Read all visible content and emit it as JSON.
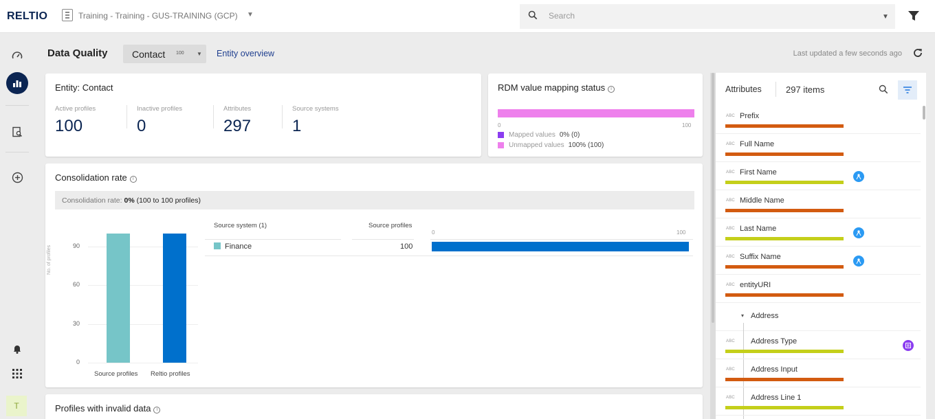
{
  "app": {
    "logo": "RELTIO",
    "tenant": "Training - Training - GUS-TRAINING (GCP)",
    "search_placeholder": "Search"
  },
  "icons": {
    "dashboard": "gauge-icon",
    "data_quality": "bar-chart-icon",
    "search_page": "document-search-icon",
    "add": "plus-circle-icon",
    "notifications": "bell-icon",
    "apps": "grid-icon",
    "filter": "funnel-icon",
    "refresh": "refresh-icon"
  },
  "colors": {
    "brand": "#0b2552",
    "mapped": "#8b3df0",
    "unmapped": "#ee80ec",
    "source_profiles_bar": "#76c5c8",
    "reltio_profiles_bar": "#0070cc",
    "quality_orange": "#d35b10",
    "quality_green": "#c4cf1a"
  },
  "user": {
    "initial": "T"
  },
  "header": {
    "title": "Data Quality",
    "entity": "Contact",
    "entity_count": "100",
    "entity_overview": "Entity overview",
    "last_updated": "Last updated a few seconds ago"
  },
  "entity_card": {
    "title": "Entity: Contact",
    "stats": [
      {
        "label": "Active profiles",
        "value": "100"
      },
      {
        "label": "Inactive profiles",
        "value": "0"
      },
      {
        "label": "Attributes",
        "value": "297"
      },
      {
        "label": "Source systems",
        "value": "1"
      }
    ]
  },
  "rdm_card": {
    "title": "RDM value mapping status",
    "axis_min": "0",
    "axis_max": "100",
    "mapped_label": "Mapped values",
    "mapped_value": "0% (0)",
    "unmapped_label": "Unmapped values",
    "unmapped_value": "100% (100)",
    "unmapped_fraction": 1.0
  },
  "consolidation": {
    "title": "Consolidation rate",
    "strip_label": "Consolidation rate:",
    "strip_value": "0%",
    "strip_detail": "(100 to 100 profiles)",
    "table": {
      "col_source": "Source system (1)",
      "col_profiles": "Source profiles",
      "axis_min": "0",
      "axis_max": "100",
      "rows": [
        {
          "name": "Finance",
          "profiles": "100",
          "value": 100
        }
      ]
    }
  },
  "chart_data": {
    "type": "bar",
    "categories": [
      "Source profiles",
      "Reltio profiles"
    ],
    "values": [
      100,
      100
    ],
    "ylabel": "No. of profiles",
    "yticks": [
      "0",
      "30",
      "60",
      "90"
    ],
    "ylim": [
      0,
      105
    ]
  },
  "invalid_card": {
    "title": "Profiles with invalid data"
  },
  "attributes": {
    "title": "Attributes",
    "count": "297 items",
    "type_tag": "ABC",
    "group_name": "Address",
    "items": [
      {
        "name": "Prefix",
        "quality": "orange"
      },
      {
        "name": "Full Name",
        "quality": "orange"
      },
      {
        "name": "First Name",
        "quality": "green",
        "badge": "person"
      },
      {
        "name": "Middle Name",
        "quality": "orange"
      },
      {
        "name": "Last Name",
        "quality": "green",
        "badge": "person"
      },
      {
        "name": "Suffix Name",
        "quality": "orange",
        "badge": "person"
      },
      {
        "name": "entityURI",
        "quality": "orange"
      }
    ],
    "sub_items": [
      {
        "name": "Address Type",
        "quality": "green",
        "badge": "lookup"
      },
      {
        "name": "Address Input",
        "quality": "orange"
      },
      {
        "name": "Address Line 1",
        "quality": "green"
      }
    ]
  }
}
